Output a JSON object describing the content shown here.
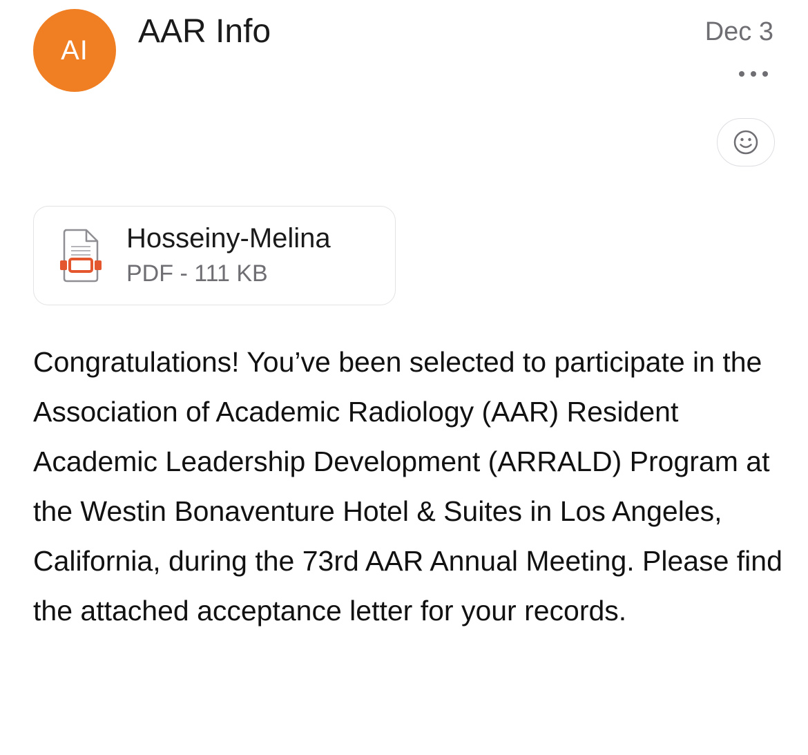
{
  "header": {
    "avatar_initials": "AI",
    "avatar_color": "#f07e23",
    "sender_name": "AAR Info",
    "date": "Dec 3"
  },
  "icons": {
    "more": "more-horizontal-icon",
    "reaction": "smiley-face-icon",
    "attachment": "pdf-file-icon"
  },
  "attachment": {
    "file_name": "Hosseiny-Melina",
    "file_meta": "PDF - 111 KB",
    "accent_color": "#e4572e"
  },
  "message": {
    "body": "Congratulations! You’ve been selected to participate in the Association of Academic Radiology (AAR) Resident Academic Leadership Development (ARRALD) Program at the Westin Bonaventure Hotel & Suites in Los Angeles, California, during the 73rd AAR Annual Meeting. Please find the attached acceptance letter for your records."
  }
}
